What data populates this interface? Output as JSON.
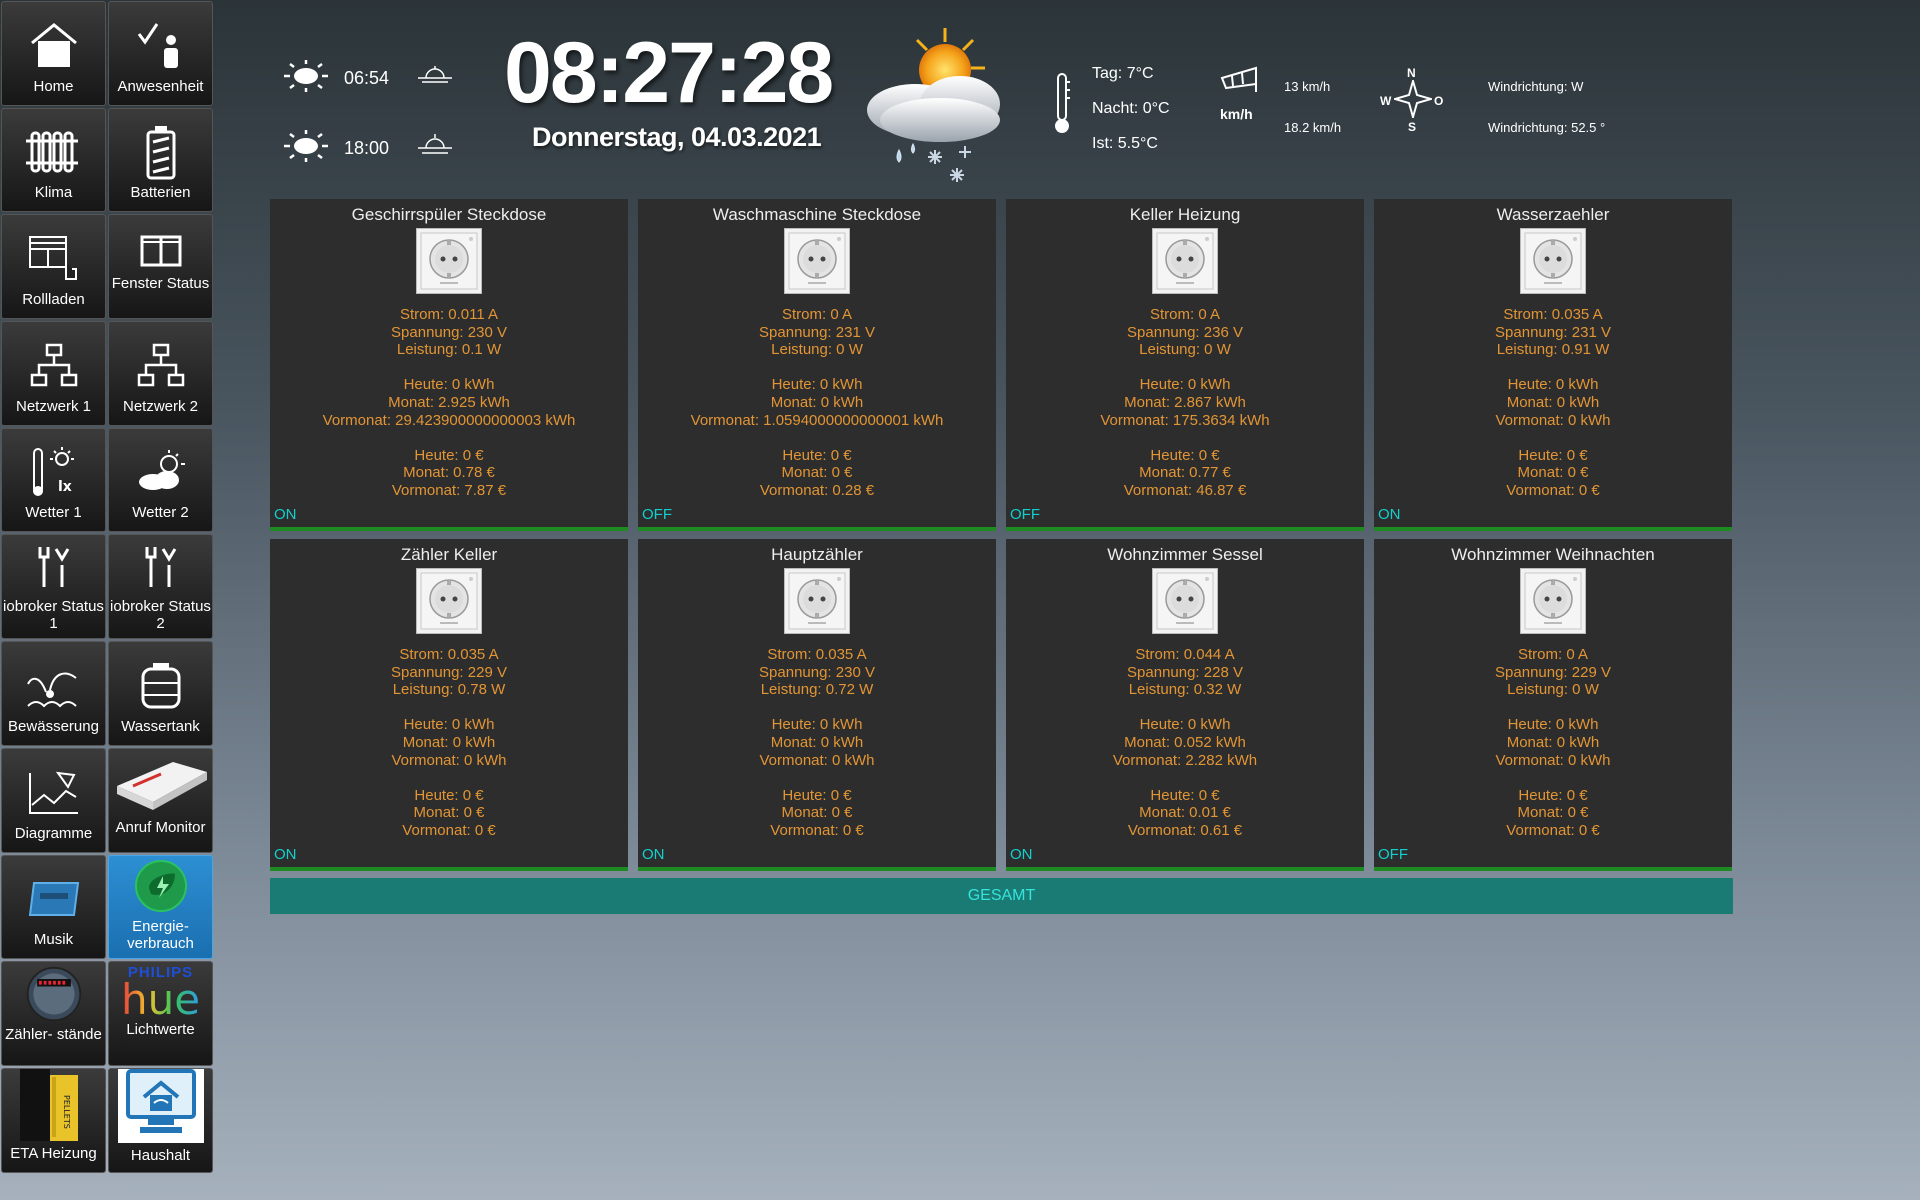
{
  "nav": [
    {
      "label": "Home",
      "icon": "home-icon"
    },
    {
      "label": "Anwesenheit",
      "icon": "presence-icon"
    },
    {
      "label": "Klima",
      "icon": "radiator-icon"
    },
    {
      "label": "Batterien",
      "icon": "battery-icon"
    },
    {
      "label": "Rollladen",
      "icon": "shutter-icon"
    },
    {
      "label": "Fenster Status",
      "icon": "window-icon"
    },
    {
      "label": "Netzwerk 1",
      "icon": "network-icon"
    },
    {
      "label": "Netzwerk 2",
      "icon": "network-icon"
    },
    {
      "label": "Wetter 1",
      "icon": "weather-sensor-icon"
    },
    {
      "label": "Wetter 2",
      "icon": "weather-cloud-icon"
    },
    {
      "label": "iobroker Status 1",
      "icon": "tools-icon"
    },
    {
      "label": "iobroker Status 2",
      "icon": "tools-icon"
    },
    {
      "label": "Bewässerung",
      "icon": "sprinkler-icon"
    },
    {
      "label": "Wassertank",
      "icon": "watertank-icon"
    },
    {
      "label": "Diagramme",
      "icon": "chart-icon"
    },
    {
      "label": "Anruf Monitor",
      "icon": "router-icon"
    },
    {
      "label": "Musik",
      "icon": "music-icon"
    },
    {
      "label": "Energie-\nverbrauch",
      "icon": "energy-icon",
      "active": true
    },
    {
      "label": "Zähler- stände",
      "icon": "meter-icon"
    },
    {
      "label": "Lichtwerte",
      "icon": "hue-logo-icon",
      "logo_top": "PHILIPS",
      "logo_main": "hue"
    },
    {
      "label": "ETA Heizung",
      "icon": "pellet-heater-icon"
    },
    {
      "label": "Haushalt",
      "icon": "smart-home-icon"
    }
  ],
  "header": {
    "sunrise": "06:54",
    "sunset": "18:00",
    "clock": "08:27:28",
    "date": "Donnerstag, 04.03.2021",
    "temp_day": "Tag: 7°C",
    "temp_night": "Nacht: 0°C",
    "temp_now": "Ist: 5.5°C",
    "wind_speed_1": "13 km/h",
    "wind_speed_2": "18.2 km/h",
    "wind_unit": "km/h",
    "wind_dir_1": "Windrichtung: W",
    "wind_dir_2": "Windrichtung: 52.5 °",
    "compass": {
      "n": "N",
      "s": "S",
      "w": "W",
      "o": "O"
    }
  },
  "cards": [
    {
      "title": "Geschirrspüler Steckdose",
      "strom": "Strom: 0.011 A",
      "spannung": "Spannung: 230 V",
      "leistung": "Leistung: 0.1 W",
      "heute_kwh": "Heute: 0 kWh",
      "monat_kwh": "Monat: 2.925 kWh",
      "vormonat_kwh": "Vormonat: 29.423900000000003 kWh",
      "heute_eur": "Heute: 0 €",
      "monat_eur": "Monat: 0.78 €",
      "vormonat_eur": "Vormonat: 7.87 €",
      "state": "ON"
    },
    {
      "title": "Waschmaschine Steckdose",
      "strom": "Strom: 0 A",
      "spannung": "Spannung: 231 V",
      "leistung": "Leistung: 0 W",
      "heute_kwh": "Heute: 0 kWh",
      "monat_kwh": "Monat: 0 kWh",
      "vormonat_kwh": "Vormonat: 1.0594000000000001 kWh",
      "heute_eur": "Heute: 0 €",
      "monat_eur": "Monat: 0 €",
      "vormonat_eur": "Vormonat: 0.28 €",
      "state": "OFF"
    },
    {
      "title": "Keller Heizung",
      "strom": "Strom: 0 A",
      "spannung": "Spannung: 236 V",
      "leistung": "Leistung: 0 W",
      "heute_kwh": "Heute: 0 kWh",
      "monat_kwh": "Monat: 2.867 kWh",
      "vormonat_kwh": "Vormonat: 175.3634 kWh",
      "heute_eur": "Heute: 0 €",
      "monat_eur": "Monat: 0.77 €",
      "vormonat_eur": "Vormonat: 46.87 €",
      "state": "OFF"
    },
    {
      "title": "Wasserzaehler",
      "strom": "Strom: 0.035 A",
      "spannung": "Spannung: 231 V",
      "leistung": "Leistung: 0.91 W",
      "heute_kwh": "Heute: 0 kWh",
      "monat_kwh": "Monat: 0 kWh",
      "vormonat_kwh": "Vormonat: 0 kWh",
      "heute_eur": "Heute: 0 €",
      "monat_eur": "Monat: 0 €",
      "vormonat_eur": "Vormonat: 0 €",
      "state": "ON"
    },
    {
      "title": "Zähler Keller",
      "strom": "Strom: 0.035 A",
      "spannung": "Spannung: 229 V",
      "leistung": "Leistung: 0.78 W",
      "heute_kwh": "Heute: 0 kWh",
      "monat_kwh": "Monat: 0 kWh",
      "vormonat_kwh": "Vormonat: 0 kWh",
      "heute_eur": "Heute: 0 €",
      "monat_eur": "Monat: 0 €",
      "vormonat_eur": "Vormonat: 0 €",
      "state": "ON"
    },
    {
      "title": "Hauptzähler",
      "strom": "Strom: 0.035 A",
      "spannung": "Spannung: 230 V",
      "leistung": "Leistung: 0.72 W",
      "heute_kwh": "Heute: 0 kWh",
      "monat_kwh": "Monat: 0 kWh",
      "vormonat_kwh": "Vormonat: 0 kWh",
      "heute_eur": "Heute: 0 €",
      "monat_eur": "Monat: 0 €",
      "vormonat_eur": "Vormonat: 0 €",
      "state": "ON"
    },
    {
      "title": "Wohnzimmer Sessel",
      "strom": "Strom: 0.044 A",
      "spannung": "Spannung: 228 V",
      "leistung": "Leistung: 0.32 W",
      "heute_kwh": "Heute: 0 kWh",
      "monat_kwh": "Monat: 0.052 kWh",
      "vormonat_kwh": "Vormonat: 2.282 kWh",
      "heute_eur": "Heute: 0 €",
      "monat_eur": "Monat: 0.01 €",
      "vormonat_eur": "Vormonat: 0.61 €",
      "state": "ON"
    },
    {
      "title": "Wohnzimmer Weihnachten",
      "strom": "Strom: 0 A",
      "spannung": "Spannung: 229 V",
      "leistung": "Leistung: 0 W",
      "heute_kwh": "Heute: 0 kWh",
      "monat_kwh": "Monat: 0 kWh",
      "vormonat_kwh": "Vormonat: 0 kWh",
      "heute_eur": "Heute: 0 €",
      "monat_eur": "Monat: 0 €",
      "vormonat_eur": "Vormonat: 0 €",
      "state": "OFF"
    }
  ],
  "gesamt_label": "GESAMT",
  "colors": {
    "value_text": "#e29535",
    "state_text": "#11d0d0",
    "card_bar": "#1e8b22",
    "gesamt_bg": "#1a7b75",
    "active_tile": "#2d8fd3"
  }
}
